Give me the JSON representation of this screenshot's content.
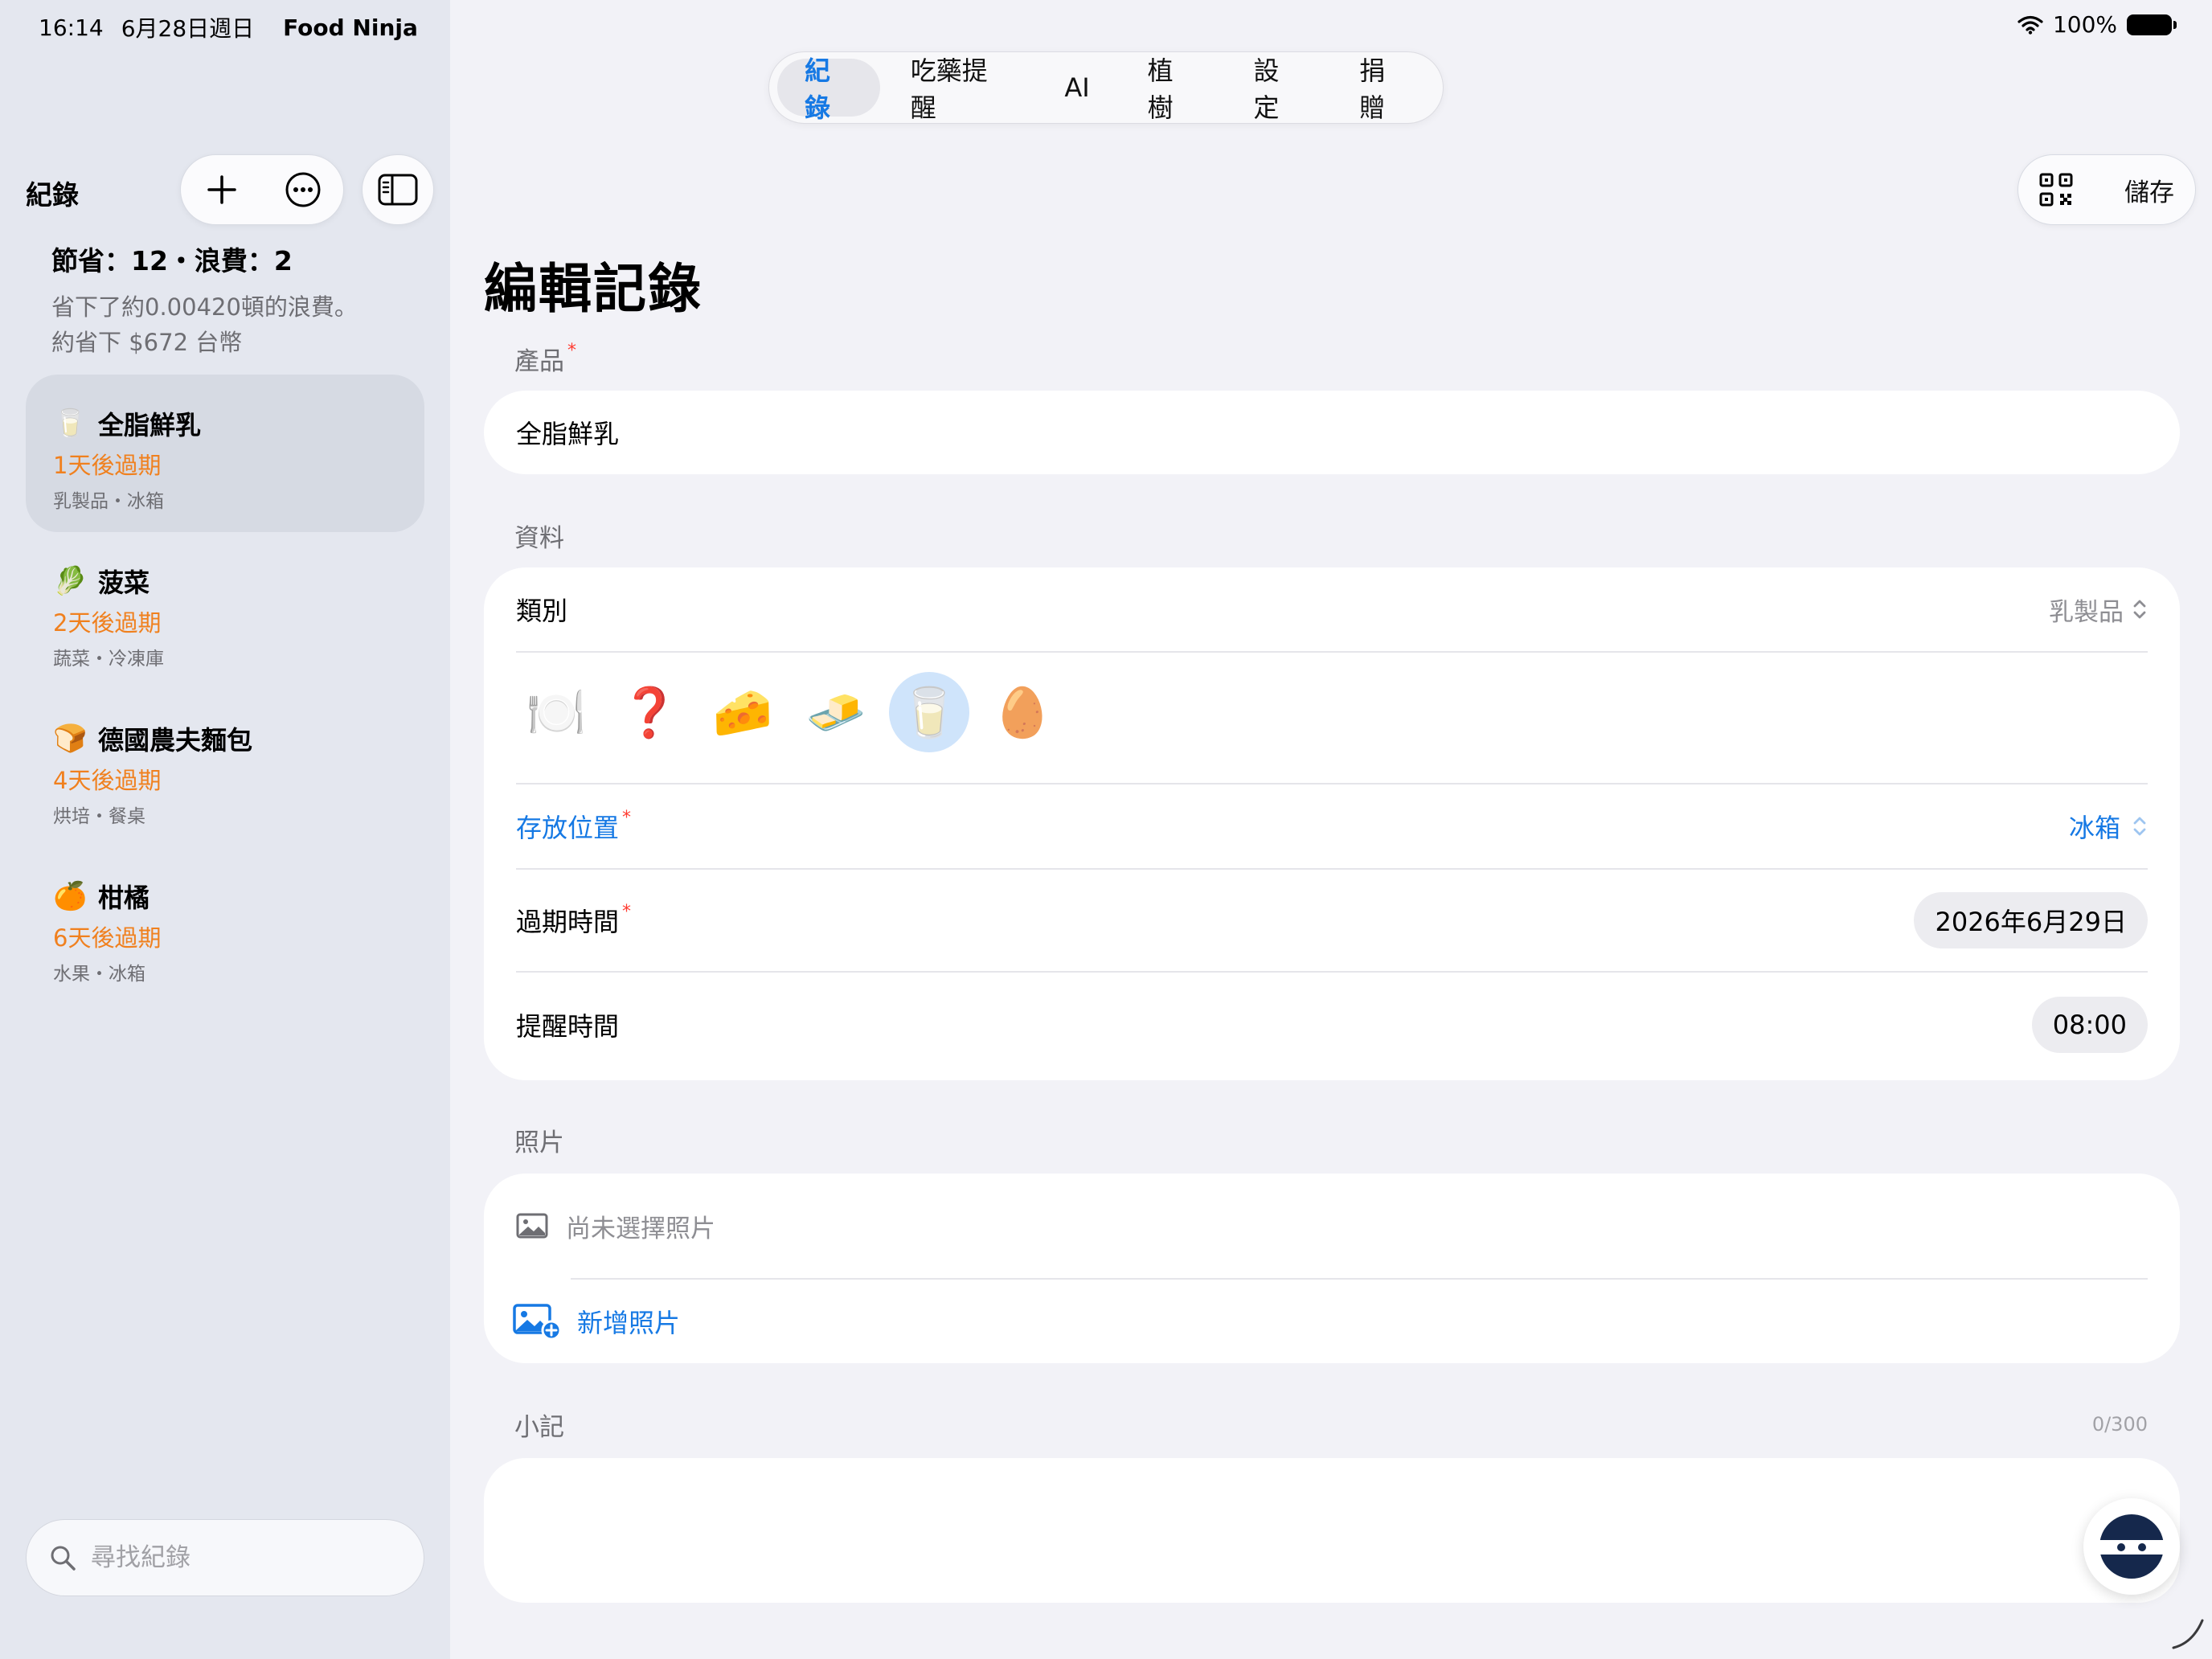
{
  "status": {
    "time": "16:14",
    "date": "6月28日週日",
    "app": "Food Ninja",
    "battery": "100%"
  },
  "sidebar": {
    "title": "紀錄",
    "summary": {
      "headline": "節省：12・浪費：2",
      "line1": "省下了約0.00420頓的浪費。",
      "line2": "約省下 $672 台幣"
    },
    "records": [
      {
        "emoji": "🥛",
        "name": "全脂鮮乳",
        "expiry": "1天後過期",
        "meta": "乳製品・冰箱",
        "selected": true
      },
      {
        "emoji": "🥬",
        "name": "菠菜",
        "expiry": "2天後過期",
        "meta": "蔬菜・冷凍庫",
        "selected": false
      },
      {
        "emoji": "🍞",
        "name": "德國農夫麵包",
        "expiry": "4天後過期",
        "meta": "烘培・餐桌",
        "selected": false
      },
      {
        "emoji": "🍊",
        "name": "柑橘",
        "expiry": "6天後過期",
        "meta": "水果・冰箱",
        "selected": false
      }
    ],
    "search_placeholder": "尋找紀錄"
  },
  "tabs": [
    "紀錄",
    "吃藥提醒",
    "AI",
    "植樹",
    "設定",
    "捐贈"
  ],
  "active_tab": 0,
  "toolbar": {
    "save_label": "儲存"
  },
  "editor": {
    "title": "編輯記錄",
    "product_label": "產品",
    "product_value": "全脂鮮乳",
    "data_label": "資料",
    "category_label": "類別",
    "category_value": "乳製品",
    "emoji_options": [
      "🍽️",
      "❓",
      "🧀",
      "🧈",
      "🥛",
      "🥚"
    ],
    "selected_emoji_index": 4,
    "storage_label": "存放位置",
    "storage_value": "冰箱",
    "expiry_label": "過期時間",
    "expiry_value": "2026年6月29日",
    "reminder_label": "提醒時間",
    "reminder_value": "08:00",
    "photo_section_label": "照片",
    "photo_empty_text": "尚未選擇照片",
    "add_photo_label": "新增照片",
    "note_section_label": "小記",
    "note_counter": "0/300"
  },
  "colors": {
    "accent": "#1679e4",
    "expiry": "#f0801e",
    "required": "#ff3b30"
  }
}
